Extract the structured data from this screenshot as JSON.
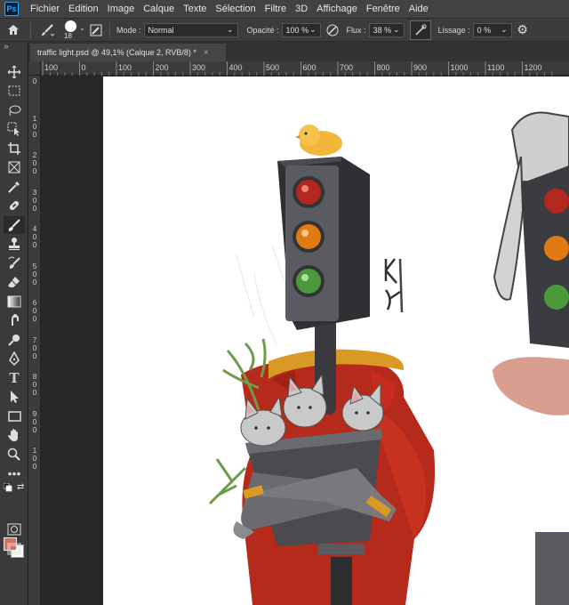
{
  "menubar": {
    "logo": "Ps",
    "items": [
      "Fichier",
      "Edition",
      "Image",
      "Calque",
      "Texte",
      "Sélection",
      "Filtre",
      "3D",
      "Affichage",
      "Fenêtre",
      "Aide"
    ]
  },
  "options": {
    "brush_size": "18",
    "mode_label": "Mode :",
    "mode_value": "Normal",
    "opacity_label": "Opacité :",
    "opacity_value": "100 %",
    "flow_label": "Flux :",
    "flow_value": "38 %",
    "smoothing_label": "Lissage :",
    "smoothing_value": "0 %"
  },
  "document": {
    "tab_title": "traffic light.psd @ 49,1% (Calque 2, RVB/8) *",
    "close": "×"
  },
  "ruler": {
    "top_ticks": [
      "100",
      "0",
      "100",
      "200",
      "300",
      "400",
      "500",
      "600",
      "700",
      "800",
      "900",
      "1000",
      "1100",
      "1200"
    ],
    "left_ticks": [
      "0",
      "1\n0\n0",
      "2\n0\n0",
      "3\n0\n0",
      "4\n0\n0",
      "5\n0\n0",
      "6\n0\n0",
      "7\n0\n0",
      "8\n0\n0",
      "9\n0\n0",
      "1\n0\n0"
    ]
  },
  "toolbar": {
    "collapse": "»",
    "tools": [
      "move-tool",
      "marquee-tool",
      "lasso-tool",
      "object-select-tool",
      "crop-tool",
      "frame-tool",
      "eyedropper-tool",
      "healing-tool",
      "brush-tool",
      "stamp-tool",
      "history-brush-tool",
      "eraser-tool",
      "gradient-tool",
      "smudge-tool",
      "dodge-tool",
      "pen-tool",
      "type-tool",
      "path-select-tool",
      "rectangle-tool",
      "hand-tool",
      "zoom-tool",
      "more-tools"
    ],
    "type_glyph": "T"
  },
  "colors": {
    "foreground": "#e06a5f",
    "background": "#ffffff"
  },
  "artwork": {
    "signature": "KY"
  }
}
